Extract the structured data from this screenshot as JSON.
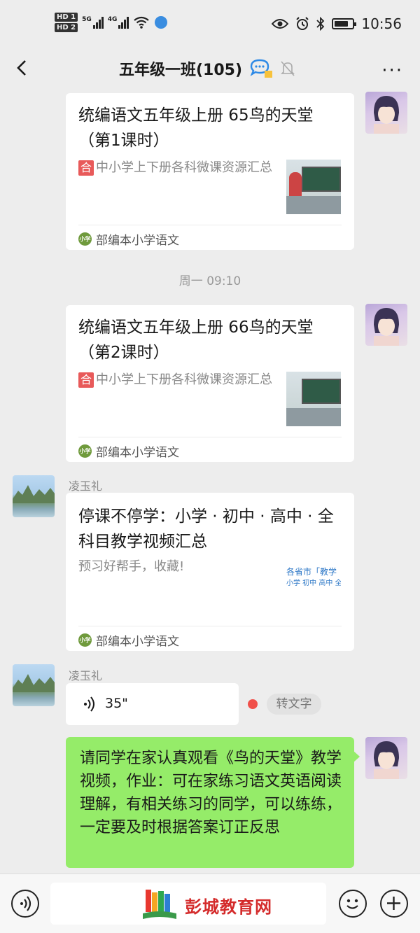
{
  "status_bar": {
    "hd1": "HD 1",
    "hd2": "HD 2",
    "net1": "5G",
    "net2": "4G",
    "time": "10:56",
    "battery_level": 0.8
  },
  "nav": {
    "title": "五年级一班(105)"
  },
  "messages": {
    "card1": {
      "title": "统编语文五年级上册 65鸟的天堂（第1课时）",
      "tag": "合",
      "subtitle": "中小学上下册各科微课资源汇总",
      "source": "部编本小学语文"
    },
    "timestamp": "周一 09:10",
    "card2": {
      "title": "统编语文五年级上册 66鸟的天堂（第2课时）",
      "tag": "合",
      "subtitle": "中小学上下册各科微课资源汇总",
      "source": "部编本小学语文"
    },
    "sender1": "凌玉礼",
    "card3": {
      "title": "停课不停学：小学 · 初中 · 高中 · 全科目教学视频汇总",
      "subtitle": "预习好帮手，收藏!",
      "thumb_line1": "各省市「教学",
      "thumb_line2": "小学 初中 高中 全",
      "source": "部编本小学语文"
    },
    "sender2": "凌玉礼",
    "voice": {
      "duration": "35\"",
      "to_text": "转文字"
    },
    "text_message": "请同学在家认真观看《鸟的天堂》教学视频，作业：可在家练习语文英语阅读理解，有相关练习的同学，可以练练，一定要及时根据答案订正反思"
  },
  "bottom": {
    "watermark": "彭城教育网"
  },
  "colors": {
    "bubble_green": "#95ec69",
    "tag_red": "#e85a5a",
    "watermark_red": "#d42b2b"
  }
}
